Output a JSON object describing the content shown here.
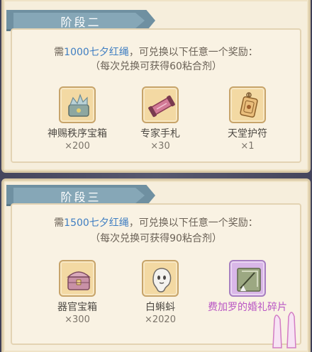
{
  "stages": [
    {
      "title": "阶段二",
      "desc_prefix": "需",
      "desc_highlight": "1000七夕红绳",
      "desc_suffix": "，可兑换以下任意一个奖励：",
      "desc_note": "（每次兑换可获得60粘合剂）",
      "rewards": [
        {
          "name": "神赐秩序宝箱",
          "qty": "×200",
          "icon": "crystal-chest-icon"
        },
        {
          "name": "专家手札",
          "qty": "×30",
          "icon": "scroll-icon"
        },
        {
          "name": "天堂护符",
          "qty": "×1",
          "icon": "amulet-icon"
        }
      ]
    },
    {
      "title": "阶段三",
      "desc_prefix": "需",
      "desc_highlight": "1500七夕红绳",
      "desc_suffix": "，可兑换以下任意一个奖励：",
      "desc_note": "（每次兑换可获得90粘合剂）",
      "rewards": [
        {
          "name": "器官宝箱",
          "qty": "×300",
          "icon": "organ-chest-icon"
        },
        {
          "name": "白蝌蚪",
          "qty": "×2020",
          "icon": "white-tadpole-icon"
        },
        {
          "name": "费加罗的婚礼碎片",
          "qty": "",
          "icon": "wedding-fragment-icon"
        }
      ]
    }
  ],
  "colors": {
    "highlight": "#3f7ec2",
    "tab": "#6f90a1",
    "rare_name": "#b955c4"
  }
}
